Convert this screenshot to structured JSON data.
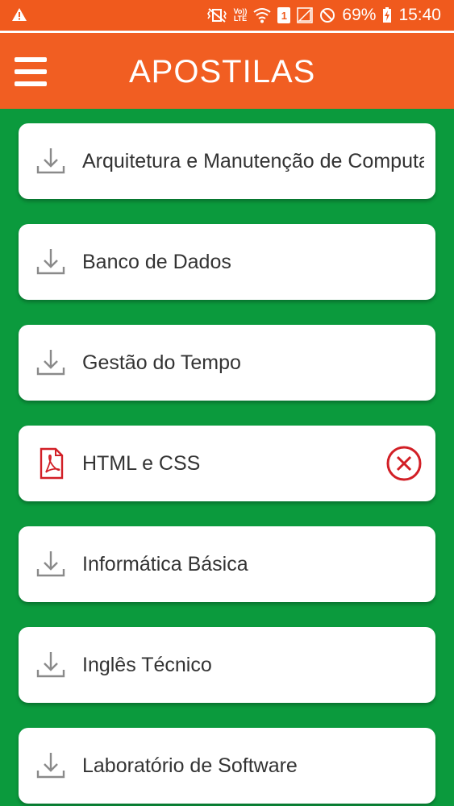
{
  "status_bar": {
    "battery": "69%",
    "time": "15:40",
    "sim_slot": "1",
    "volte_top": "Vo))",
    "volte_bottom": "LTE"
  },
  "app_bar": {
    "title": "APOSTILAS"
  },
  "colors": {
    "app_bar": "#f15e22",
    "background": "#0b9a3d",
    "pdf_red": "#d21f26",
    "download_gray": "#8a8a8a"
  },
  "items": [
    {
      "label": "Arquitetura e Manutenção de Computadores",
      "icon": "download-icon"
    },
    {
      "label": "Banco de Dados",
      "icon": "download-icon"
    },
    {
      "label": "Gestão do Tempo",
      "icon": "download-icon"
    },
    {
      "label": "HTML e CSS",
      "icon": "pdf-icon",
      "removable": true
    },
    {
      "label": "Informática Básica",
      "icon": "download-icon"
    },
    {
      "label": "Inglês Técnico",
      "icon": "download-icon"
    },
    {
      "label": "Laboratório de Software",
      "icon": "download-icon"
    }
  ]
}
